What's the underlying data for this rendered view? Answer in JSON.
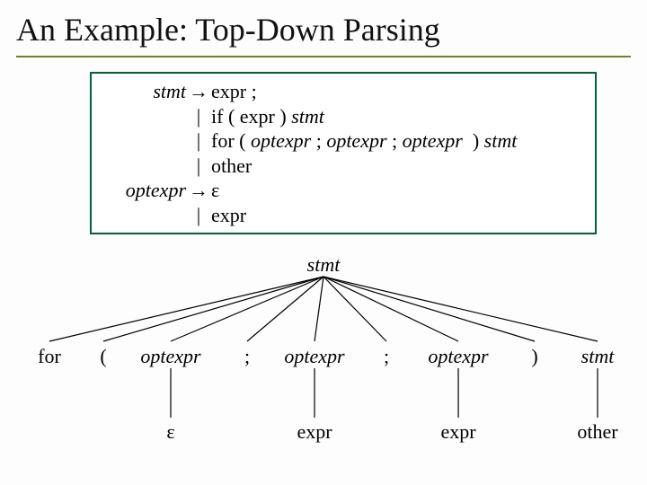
{
  "title": "An Example: Top-Down Parsing",
  "grammar": {
    "stmt_lhs": "stmt",
    "optexpr_lhs": "optexpr",
    "arrow": "→",
    "bar": "|",
    "prod1": "expr ;",
    "prod2_pre": "if ( expr ) ",
    "prod2_tail": "stmt",
    "prod3_pre": "for ( ",
    "prod3_o1": "optexpr",
    "prod3_s1": " ; ",
    "prod3_o2": "optexpr",
    "prod3_s2": " ; ",
    "prod3_o3": "optexpr",
    "prod3_s3": "  ) ",
    "prod3_tail": "stmt",
    "prod4": "other",
    "eps": "ε",
    "prod6": "expr"
  },
  "tree": {
    "root": "stmt",
    "c1": "for",
    "c2": "(",
    "c3": "optexpr",
    "c4": ";",
    "c5": "optexpr",
    "c6": ";",
    "c7": "optexpr",
    "c8": ")",
    "c9": "stmt",
    "g3": "ε",
    "g5": "expr",
    "g7": "expr",
    "g9": "other"
  },
  "chart_data": {
    "type": "tree",
    "layout": "parse-tree",
    "root": {
      "label": "stmt",
      "italic": true,
      "children": [
        {
          "label": "for",
          "italic": false,
          "children": []
        },
        {
          "label": "(",
          "italic": false,
          "children": []
        },
        {
          "label": "optexpr",
          "italic": true,
          "children": [
            {
              "label": "ε",
              "italic": false,
              "children": []
            }
          ]
        },
        {
          "label": ";",
          "italic": false,
          "children": []
        },
        {
          "label": "optexpr",
          "italic": true,
          "children": [
            {
              "label": "expr",
              "italic": false,
              "children": []
            }
          ]
        },
        {
          "label": ";",
          "italic": false,
          "children": []
        },
        {
          "label": "optexpr",
          "italic": true,
          "children": [
            {
              "label": "expr",
              "italic": false,
              "children": []
            }
          ]
        },
        {
          "label": ")",
          "italic": false,
          "children": []
        },
        {
          "label": "stmt",
          "italic": true,
          "children": [
            {
              "label": "other",
              "italic": false,
              "children": []
            }
          ]
        }
      ]
    },
    "grammar_rules": [
      "stmt → expr ;",
      "stmt → if ( expr ) stmt",
      "stmt → for ( optexpr ; optexpr ; optexpr ) stmt",
      "stmt → other",
      "optexpr → ε",
      "optexpr → expr"
    ]
  }
}
